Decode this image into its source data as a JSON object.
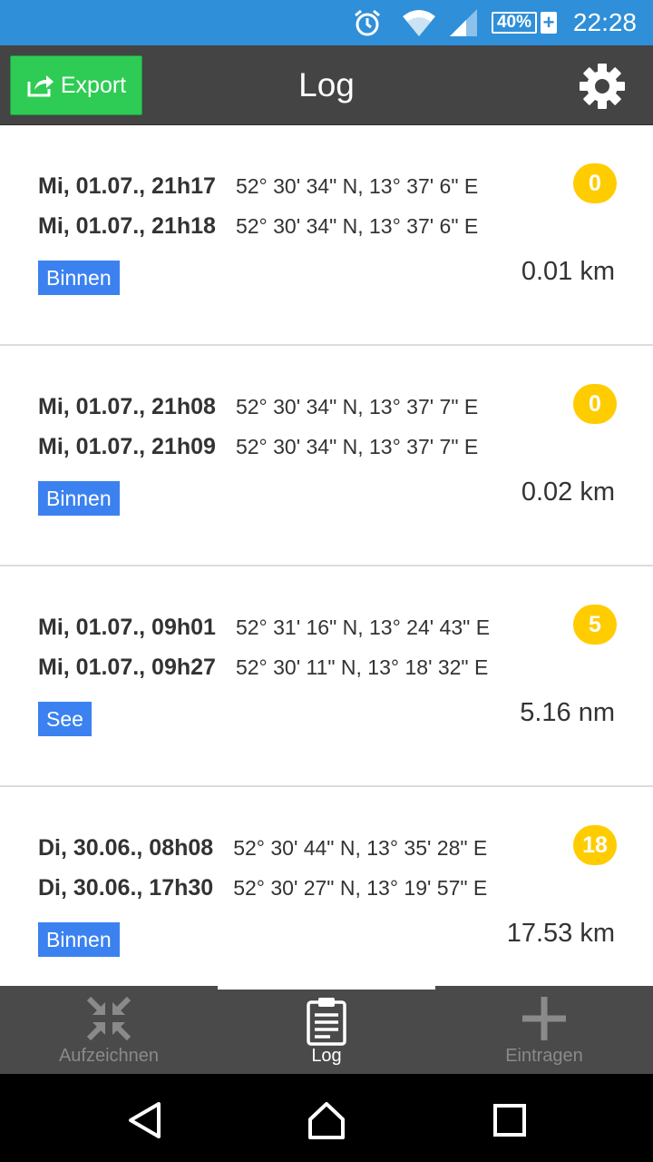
{
  "status_bar": {
    "time": "22:28",
    "battery": "40%",
    "battery_charging_symbol": "+",
    "icons": [
      "alarm-icon",
      "wifi-icon",
      "signal-icon",
      "battery-icon"
    ]
  },
  "toolbar": {
    "export_label": "Export",
    "title": "Log",
    "icons": [
      "export-icon",
      "gear-icon"
    ]
  },
  "entries": [
    {
      "start_time": "Mi, 01.07., 21h17",
      "start_pos": "52° 30' 34\" N, 13° 37' 6\" E",
      "end_time": "Mi, 01.07., 21h18",
      "end_pos": "52° 30' 34\" N, 13° 37' 6\" E",
      "badge": "0",
      "tag": "Binnen",
      "distance": "0.01 km"
    },
    {
      "start_time": "Mi, 01.07., 21h08",
      "start_pos": "52° 30' 34\" N, 13° 37' 7\" E",
      "end_time": "Mi, 01.07., 21h09",
      "end_pos": "52° 30' 34\" N, 13° 37' 7\" E",
      "badge": "0",
      "tag": "Binnen",
      "distance": "0.02 km"
    },
    {
      "start_time": "Mi, 01.07., 09h01",
      "start_pos": "52° 31' 16\" N, 13° 24' 43\" E",
      "end_time": "Mi, 01.07., 09h27",
      "end_pos": "52° 30' 11\" N, 13° 18' 32\" E",
      "badge": "5",
      "tag": "See",
      "distance": "5.16 nm"
    },
    {
      "start_time": "Di, 30.06., 08h08",
      "start_pos": "52° 30' 44\" N, 13° 35' 28\" E",
      "end_time": "Di, 30.06., 17h30",
      "end_pos": "52° 30' 27\" N, 13° 19' 57\" E",
      "badge": "18",
      "tag": "Binnen",
      "distance": "17.53 km"
    }
  ],
  "bottom_nav": [
    {
      "label": "Aufzeichnen",
      "icon": "compress-arrows-icon",
      "active": false
    },
    {
      "label": "Log",
      "icon": "clipboard-icon",
      "active": true
    },
    {
      "label": "Eintragen",
      "icon": "plus-icon",
      "active": false
    }
  ],
  "system_nav": [
    "back-icon",
    "home-icon",
    "recents-icon"
  ]
}
